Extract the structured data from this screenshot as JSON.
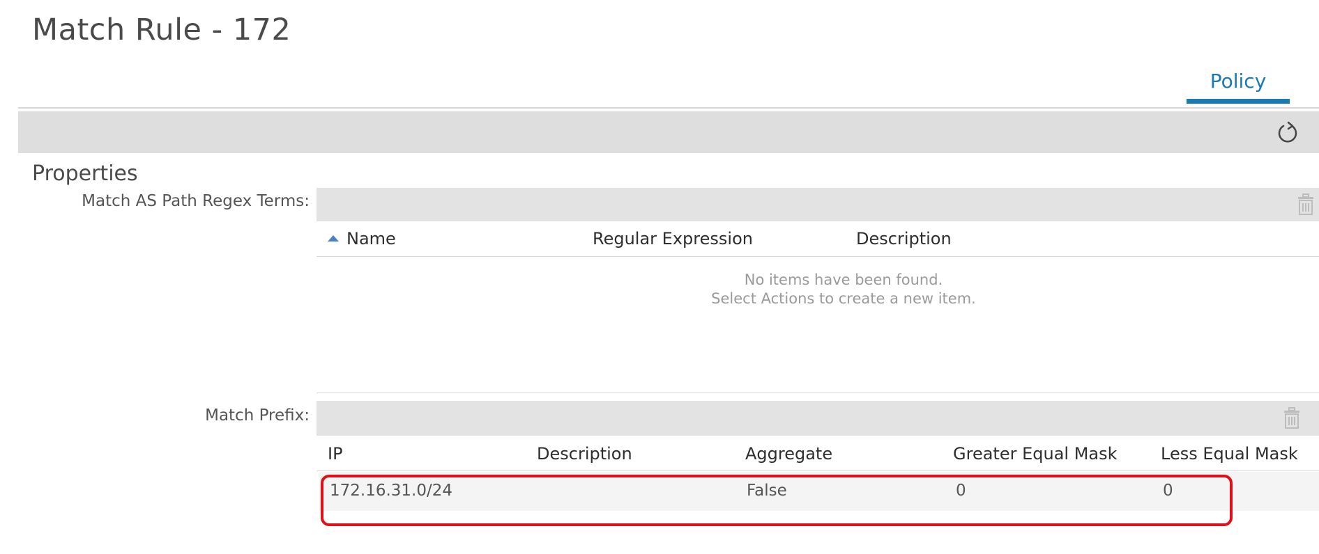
{
  "page": {
    "title": "Match Rule - 172"
  },
  "tabs": [
    {
      "label": "Policy",
      "active": true
    }
  ],
  "toolbar": {
    "refresh_icon": "refresh-icon",
    "overflow_glyph": "."
  },
  "properties": {
    "heading": "Properties",
    "as_path_regex": {
      "label": "Match AS Path Regex Terms:",
      "columns": [
        "Name",
        "Regular Expression",
        "Description"
      ],
      "sort_column": "Name",
      "sort_direction": "ascending",
      "empty_line1": "No items have been found.",
      "empty_line2": "Select Actions to create a new item.",
      "rows": []
    },
    "match_prefix": {
      "label": "Match Prefix:",
      "columns": [
        "IP",
        "Description",
        "Aggregate",
        "Greater Equal Mask",
        "Less Equal Mask"
      ],
      "rows": [
        {
          "ip": "172.16.31.0/24",
          "description": "",
          "aggregate": "False",
          "greater_equal_mask": "0",
          "less_equal_mask": "0"
        }
      ]
    }
  },
  "colors": {
    "accent": "#1a7ab3",
    "highlight": "#e00f19",
    "sort_arrow": "#4a80c8"
  }
}
